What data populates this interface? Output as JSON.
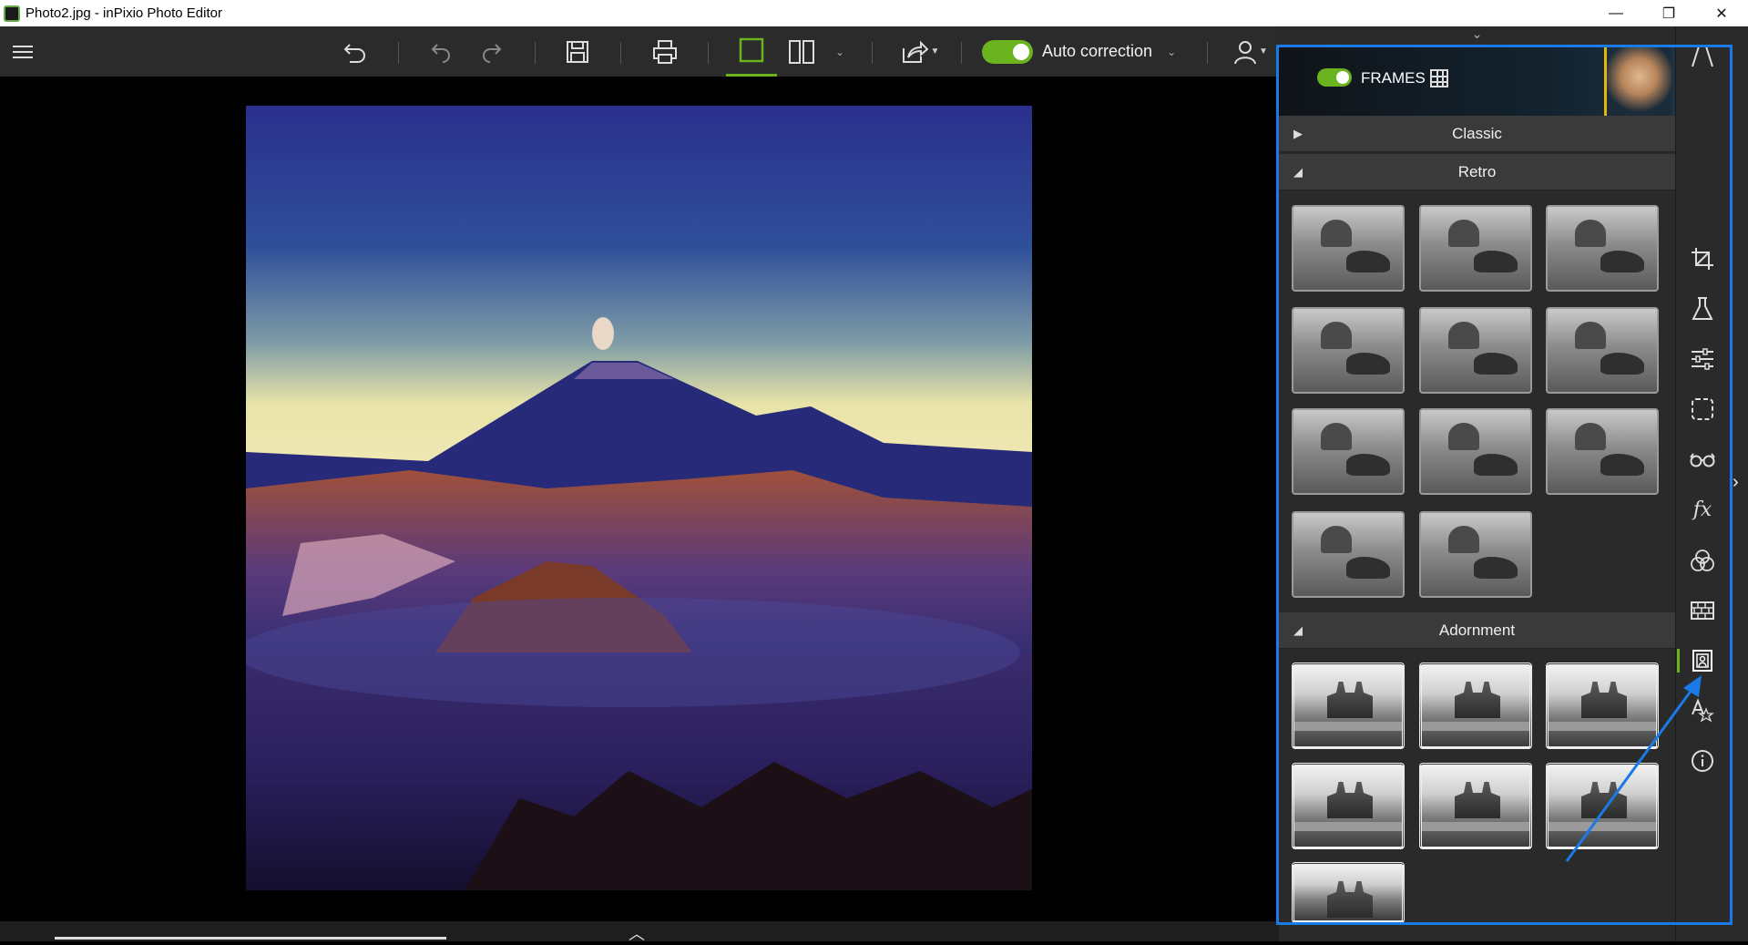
{
  "window": {
    "title": "Photo2.jpg - inPixio Photo Editor",
    "controls": [
      "minimize",
      "restore",
      "close"
    ]
  },
  "toolbar": {
    "menu_icon": "hamburger-icon",
    "auto_correction": {
      "label": "Auto correction",
      "enabled": true
    },
    "accent_color": "#6cb320"
  },
  "panel": {
    "header": {
      "label": "FRAMES",
      "enabled": true
    },
    "sections": [
      {
        "name": "Classic",
        "expanded": false
      },
      {
        "name": "Retro",
        "expanded": true,
        "thumbnail_count": 11
      },
      {
        "name": "Adornment",
        "expanded": true,
        "thumbnail_count": 7
      }
    ]
  },
  "sidebar": {
    "items": [
      {
        "icon": "perspective-icon"
      },
      {
        "icon": "crop-icon"
      },
      {
        "icon": "flask-icon"
      },
      {
        "icon": "adjust-sliders-icon"
      },
      {
        "icon": "selection-icon"
      },
      {
        "icon": "glasses-icon"
      },
      {
        "icon": "fx-icon"
      },
      {
        "icon": "color-circles-icon"
      },
      {
        "icon": "texture-grid-icon"
      },
      {
        "icon": "frame-icon",
        "active": true
      },
      {
        "icon": "text-icon"
      },
      {
        "icon": "info-icon"
      }
    ]
  },
  "highlight_color": "#1a7ae8"
}
